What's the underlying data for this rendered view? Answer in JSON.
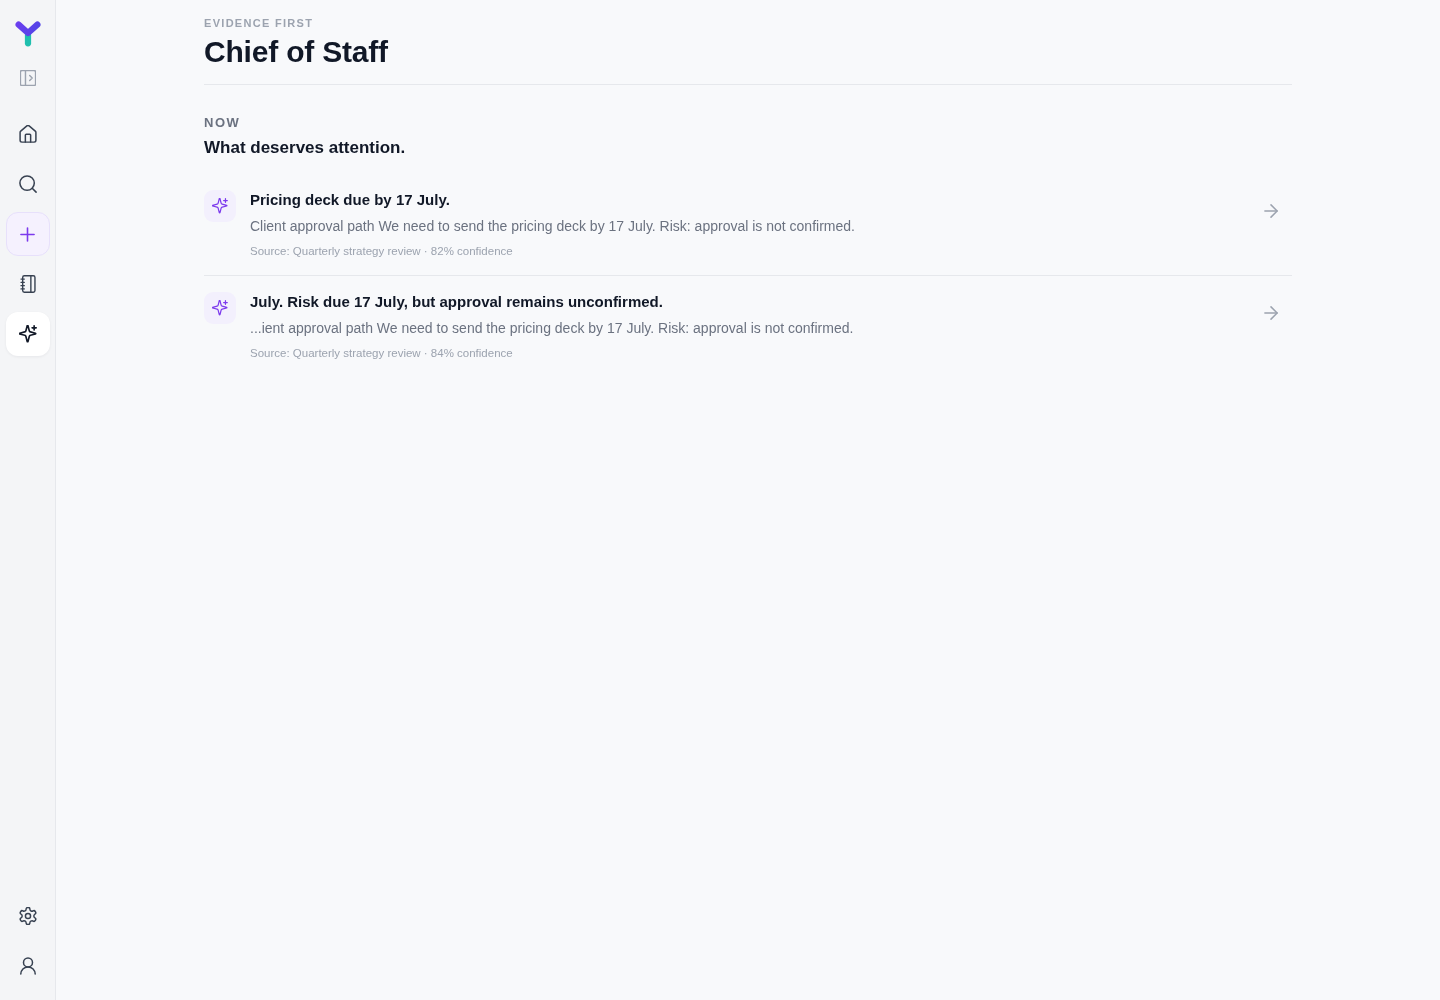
{
  "sidebar": {
    "items": [
      {
        "kind": "link",
        "selected": false
      },
      {
        "kind": "link",
        "selected": false
      },
      {
        "kind": "create",
        "selected": false
      },
      {
        "kind": "link",
        "selected": false
      },
      {
        "kind": "link",
        "selected": true
      }
    ]
  },
  "header": {
    "eyebrow": "EVIDENCE FIRST",
    "title": "Chief of Staff"
  },
  "section": {
    "eyebrow": "NOW",
    "heading": "What deserves attention.",
    "items": [
      {
        "title": "Pricing deck due by 17 July.",
        "summary": "Client approval path We need to send the pricing deck by 17 July. Risk: approval is not confirmed.",
        "meta": "Source: Quarterly strategy review · 82% confidence"
      },
      {
        "title": "July. Risk due 17 July, but approval remains unconfirmed.",
        "summary": "...ient approval path We need to send the pricing deck by 17 July. Risk: approval is not confirmed.",
        "meta": "Source: Quarterly strategy review · 84% confidence"
      }
    ]
  }
}
